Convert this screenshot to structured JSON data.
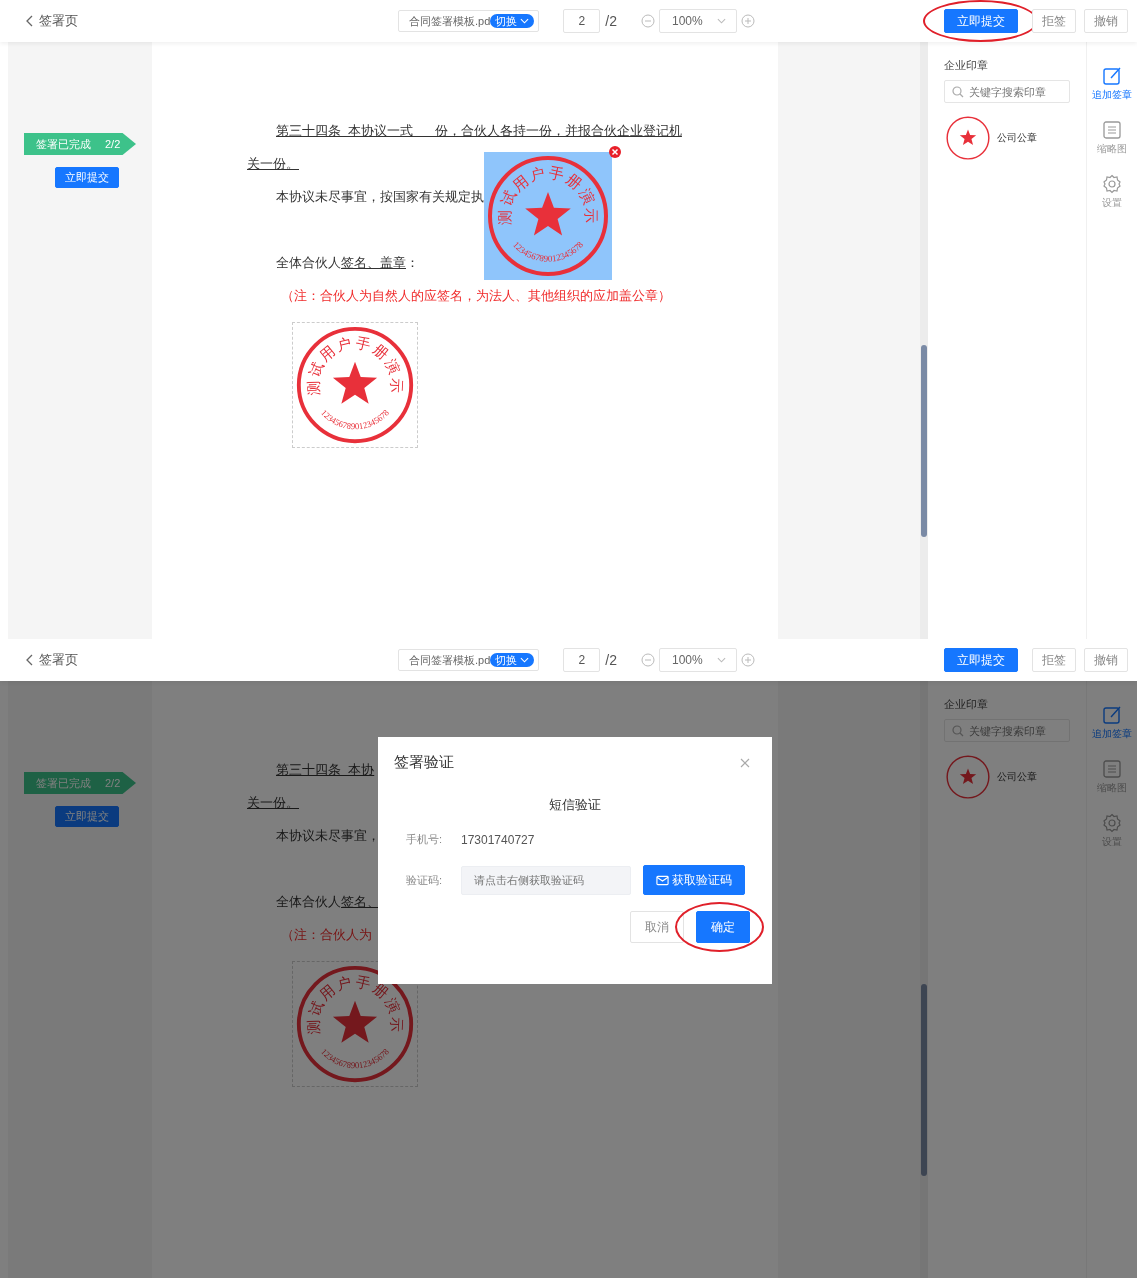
{
  "screens": [
    {
      "header": {
        "title": "签署页",
        "file": {
          "name": "合同签署模板.pd",
          "switch": "切换"
        },
        "page": {
          "value": "2",
          "total": "/2"
        },
        "zoom": {
          "value": "100%"
        },
        "actions": [
          {
            "label": "立即提交",
            "kind": "primary",
            "circled": true
          },
          {
            "label": "拒签",
            "kind": "default",
            "circled": false
          },
          {
            "label": "撤销",
            "kind": "default",
            "circled": false
          }
        ]
      },
      "progress": {
        "label": "签署已完成",
        "count": "2/2",
        "button": "立即提交"
      },
      "document": {
        "paragraphs": [
          {
            "kind": "indent",
            "parts": [
              {
                "text": "第三十四条  本协议一式      份，合伙人各持一份，并报合伙企业登记机",
                "underline": true
              }
            ]
          },
          {
            "kind": "flush",
            "parts": [
              {
                "text": "关一份。",
                "underline": true
              }
            ]
          },
          {
            "kind": "indent",
            "parts": [
              {
                "text": "本协议未尽事宜，按国家有关规定执",
                "underline": false
              }
            ]
          },
          {
            "kind": "blank"
          },
          {
            "kind": "indent",
            "parts": [
              {
                "text": "全体合伙人",
                "underline": false
              },
              {
                "text": "签名、盖章",
                "underline": true
              },
              {
                "text": "：",
                "underline": false
              }
            ]
          },
          {
            "kind": "note",
            "parts": [
              {
                "text": "（注：合伙人为自然人的应签名，为法人、其他组织的应加盖公章）",
                "underline": false
              }
            ]
          }
        ],
        "stamps": [
          {
            "kind": "placed",
            "selected": false,
            "name": "测试用户手册演示",
            "code": "123456789012345678"
          },
          {
            "kind": "floating",
            "selected": true,
            "name": "测试用户手册演示",
            "code": "123456789012345678"
          }
        ]
      },
      "panel": {
        "title": "企业印章",
        "search_placeholder": "关键字搜索印章",
        "seals": [
          {
            "name": "公司公章"
          }
        ]
      },
      "tools": [
        {
          "label": "追加签章",
          "selected": true
        },
        {
          "label": "缩略图",
          "selected": false
        },
        {
          "label": "设置",
          "selected": false
        }
      ]
    },
    {
      "header": {
        "title": "签署页",
        "file": {
          "name": "合同签署模板.pd",
          "switch": "切换"
        },
        "page": {
          "value": "2",
          "total": "/2"
        },
        "zoom": {
          "value": "100%"
        },
        "actions": [
          {
            "label": "立即提交",
            "kind": "primary",
            "circled": false
          },
          {
            "label": "拒签",
            "kind": "default",
            "circled": false
          },
          {
            "label": "撤销",
            "kind": "default",
            "circled": false
          }
        ]
      },
      "progress": {
        "label": "签署已完成",
        "count": "2/2",
        "button": "立即提交"
      },
      "document": {
        "paragraphs": [
          {
            "kind": "indent",
            "parts": [
              {
                "text": "第三十四条  本协",
                "underline": true
              }
            ]
          },
          {
            "kind": "flush",
            "parts": [
              {
                "text": "关一份。",
                "underline": true
              }
            ]
          },
          {
            "kind": "indent",
            "parts": [
              {
                "text": "本协议未尽事宜，",
                "underline": false
              }
            ]
          },
          {
            "kind": "blank"
          },
          {
            "kind": "indent",
            "parts": [
              {
                "text": "全体合伙人",
                "underline": false
              },
              {
                "text": "签名、",
                "underline": true
              }
            ]
          },
          {
            "kind": "note",
            "parts": [
              {
                "text": "（注：合伙人为",
                "underline": false
              }
            ]
          }
        ],
        "stamps": [
          {
            "kind": "placed",
            "selected": false,
            "name": "测试用户手册演示",
            "code": "123456789012345678"
          }
        ]
      },
      "panel": {
        "title": "企业印章",
        "search_placeholder": "关键字搜索印章",
        "seals": [
          {
            "name": "公司公章"
          }
        ]
      },
      "tools": [
        {
          "label": "追加签章",
          "selected": true
        },
        {
          "label": "缩略图",
          "selected": false
        },
        {
          "label": "设置",
          "selected": false
        }
      ],
      "dialog": {
        "title": "签署验证",
        "heading": "短信验证",
        "fields": [
          {
            "kind": "text",
            "label": "手机号:",
            "value": "17301740727"
          },
          {
            "kind": "input",
            "label": "验证码:",
            "placeholder": "请点击右侧获取验证码",
            "button": "获取验证码"
          }
        ],
        "buttons": [
          {
            "label": "取消",
            "kind": "default",
            "circled": false
          },
          {
            "label": "确定",
            "kind": "primary",
            "circled": true
          }
        ]
      }
    }
  ]
}
